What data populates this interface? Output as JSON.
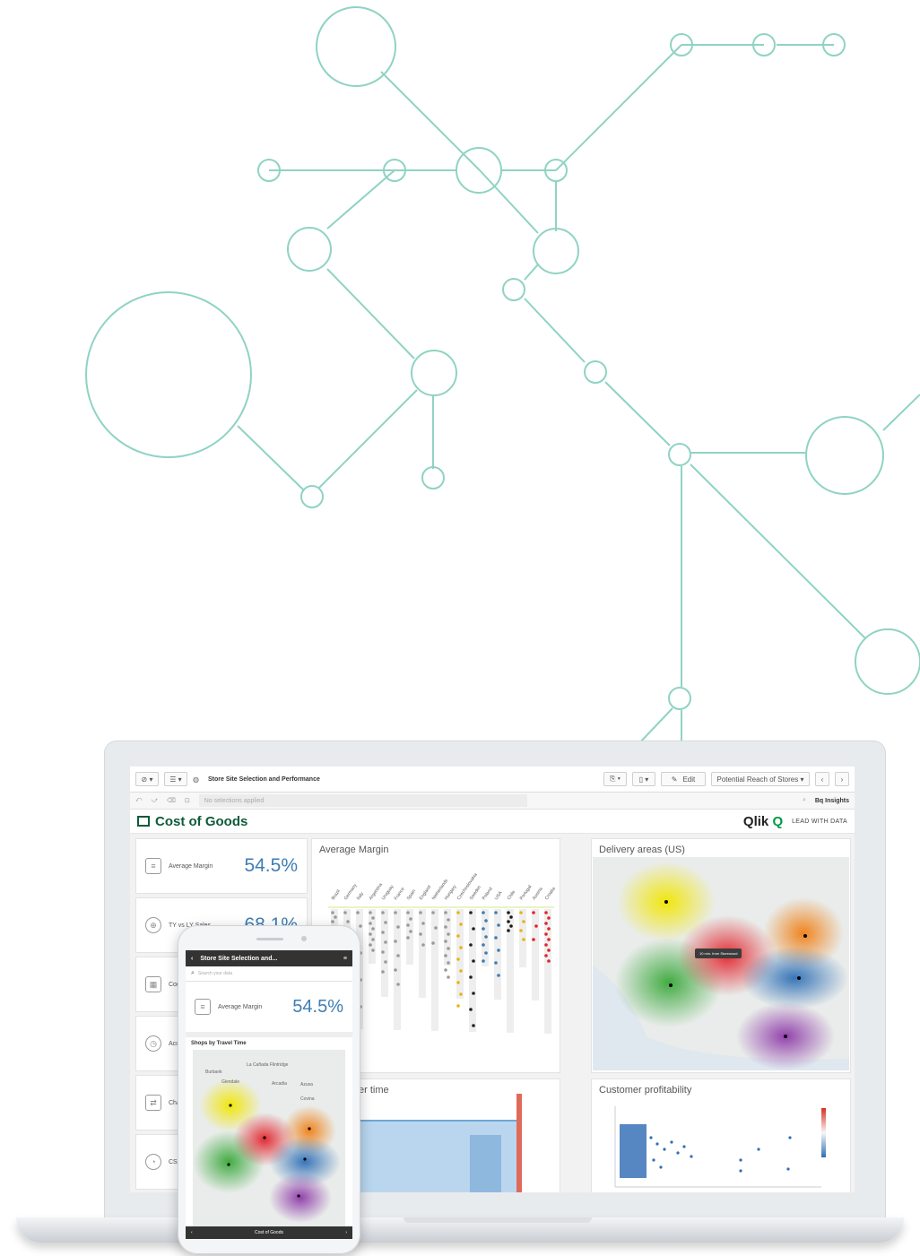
{
  "colors": {
    "network": "#8fd3c3",
    "accent": "#3f7db3",
    "brand": "#009845",
    "sheet_title": "#0e5b3a",
    "dark": "#333333"
  },
  "toolbar": {
    "nav_icon": "compass-icon",
    "list_icon": "list-icon",
    "app_title": "Store Site Selection and Performance",
    "edit_label": "Edit",
    "sheet_selector": "Potential Reach of Stores",
    "prev_icon": "chevron-left-icon",
    "next_icon": "chevron-right-icon"
  },
  "selections": {
    "empty_text": "No selections applied",
    "insights_label": "Insights"
  },
  "sheet": {
    "title": "Cost of Goods",
    "logo": "Qlik",
    "tagline": "LEAD WITH DATA"
  },
  "kpis": [
    {
      "label": "Average Margin",
      "value": "54.5%",
      "icon": "coins-icon"
    },
    {
      "label": "TY vs LY Sales",
      "value": "68.1%",
      "icon": "target-icon"
    },
    {
      "label": "Cor",
      "value": "",
      "icon": "calculator-icon"
    },
    {
      "label": "Acc",
      "value": "",
      "icon": "clock-icon"
    },
    {
      "label": "Cha",
      "value": "",
      "icon": "exchange-icon"
    },
    {
      "label": "CSAT",
      "value": "",
      "icon": "stopwatch-icon"
    }
  ],
  "panels": {
    "avg_margin": "Average Margin",
    "delivery": "Delivery areas (US)",
    "over_time": "er time",
    "customer": "Customer profitability"
  },
  "avg_margin_countries": [
    "Brazil",
    "Germany",
    "Italy",
    "Argentina",
    "Uruguay",
    "France",
    "Spain",
    "England",
    "Netherlands",
    "Hungary",
    "Czechoslovakia",
    "Sweden",
    "Poland",
    "USA",
    "Chile",
    "Portugal",
    "Austria",
    "Croatia"
  ],
  "map": {
    "tooltip": "10 min. from Storewood"
  },
  "phone": {
    "title": "Store Site Selection and...",
    "search_placeholder": "Search your data",
    "kpi_label": "Average Margin",
    "kpi_value": "54.5%",
    "map_title": "Shops by Travel Time",
    "bottom_label": "Cost of Goods",
    "map_labels": [
      "La Cañada Flintridge",
      "Burbank",
      "Glendale",
      "Arcadia",
      "Azusa",
      "Covina"
    ]
  }
}
